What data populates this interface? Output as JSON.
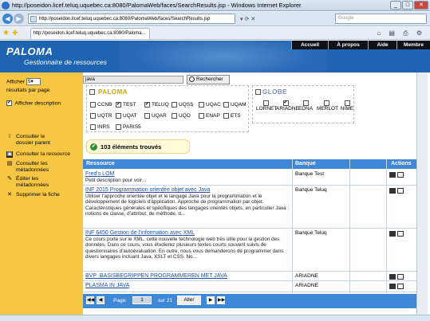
{
  "window": {
    "title": "http://poseidon.licef.teluq.uquebec.ca:8080/PalomaWeb/faces/SearchResults.jsp - Windows Internet Explorer"
  },
  "browser": {
    "address": "http://poseidon.licef.teluq.uquebec.ca:8080/PalomaWeb/faces/SearchResults.jsp",
    "search_placeholder": "Google",
    "tab_title": "http://poseidon.licef.teluq.uquebec.ca:8080/Paloma..."
  },
  "header": {
    "logo": "PALOMA",
    "subtitle": "Gestionnaire de ressources",
    "nav": [
      "Accueil",
      "À propos",
      "Aide",
      "Membre"
    ]
  },
  "sidebar": {
    "show_label": "Afficher",
    "show_value": "5",
    "per_page_label": "résultats par page",
    "show_desc_label": "Afficher description",
    "actions": [
      {
        "label": "Consulter le dossier parent",
        "icon": "folder-up-icon"
      },
      {
        "label": "Consulter la ressource",
        "icon": "view-resource-icon"
      },
      {
        "label": "Consulter les métadonnées",
        "icon": "metadata-icon"
      },
      {
        "label": "Éditer les métadonnées",
        "icon": "edit-icon"
      },
      {
        "label": "Supprimer la fiche",
        "icon": "delete-icon"
      }
    ]
  },
  "search": {
    "query": "java",
    "button": "Rechercher"
  },
  "paloma_group": {
    "logo": "PALOMA",
    "options": [
      {
        "label": "CCNB",
        "checked": false
      },
      {
        "label": "TEST",
        "checked": true
      },
      {
        "label": "TELUQ",
        "checked": true
      },
      {
        "label": "UQSS",
        "checked": false
      },
      {
        "label": "UQAC",
        "checked": false
      },
      {
        "label": "UQAM",
        "checked": false
      },
      {
        "label": "UQTR",
        "checked": false
      },
      {
        "label": "UQAT",
        "checked": false
      },
      {
        "label": "UQAR",
        "checked": false
      },
      {
        "label": "UQO",
        "checked": false
      },
      {
        "label": "ENAP",
        "checked": false
      },
      {
        "label": "ETS",
        "checked": false
      },
      {
        "label": "INRS",
        "checked": false
      },
      {
        "label": "PARIS5",
        "checked": false
      }
    ]
  },
  "globe_group": {
    "logo": "GLOBE",
    "options": [
      {
        "label": "LORNET",
        "checked": false
      },
      {
        "label": "ARIADNE",
        "checked": true
      },
      {
        "label": "EDNA",
        "checked": false
      },
      {
        "label": "MERLOT",
        "checked": false
      },
      {
        "label": "NIME",
        "checked": false
      }
    ]
  },
  "found_text": "103 éléments trouvés",
  "table": {
    "headers": {
      "resource": "Ressource",
      "bank": "Banque",
      "actions": "Actions"
    },
    "rows": [
      {
        "title": "Fred's LOM",
        "desc": "Petit description pour voir...",
        "bank": "Banque Test"
      },
      {
        "title": "INF 2015 Programmation orientée objet avec Java",
        "desc": "Utiliser l'approche orientée objet et le langage Java pour la programmation et le développement de logiciels d'application. Approche de programmation par objet. Caractéristiques générales et spécifiques des langages orientés objets, en particulier Java : notions de classe, d'attribut, de méthode, d...",
        "bank": "Banque Teluq"
      },
      {
        "title": "INF 6450 Gestion de l'information avec XML",
        "desc": "Ce cours porte sur le XML, cette nouvelle technologie web très utile pour la gestion des données. Dans ce cours, vous étudierez plusieurs textes courts souvent suivis de questionnaires d'autoévaluation. En outre, nous vous demanderons de programmer dans divers langages incluant Java, XSLT et CSS. No...",
        "bank": "Banque Teluq"
      },
      {
        "title": "BVP_BASISBEGRIPPEN PROGRAMMEREN MET JAVA",
        "desc": "",
        "bank": "ARIADNE"
      },
      {
        "title": "PLASMA IN JAVA",
        "desc": "",
        "bank": "ARIADNE"
      }
    ]
  },
  "pager": {
    "page_label": "Page:",
    "page_value": "1",
    "of_label": "sur 21",
    "go_button": "Aller"
  },
  "colors": {
    "header_blue": "#1f64b0",
    "sidebar_yellow": "#f7c642",
    "table_blue": "#3f88d8"
  }
}
